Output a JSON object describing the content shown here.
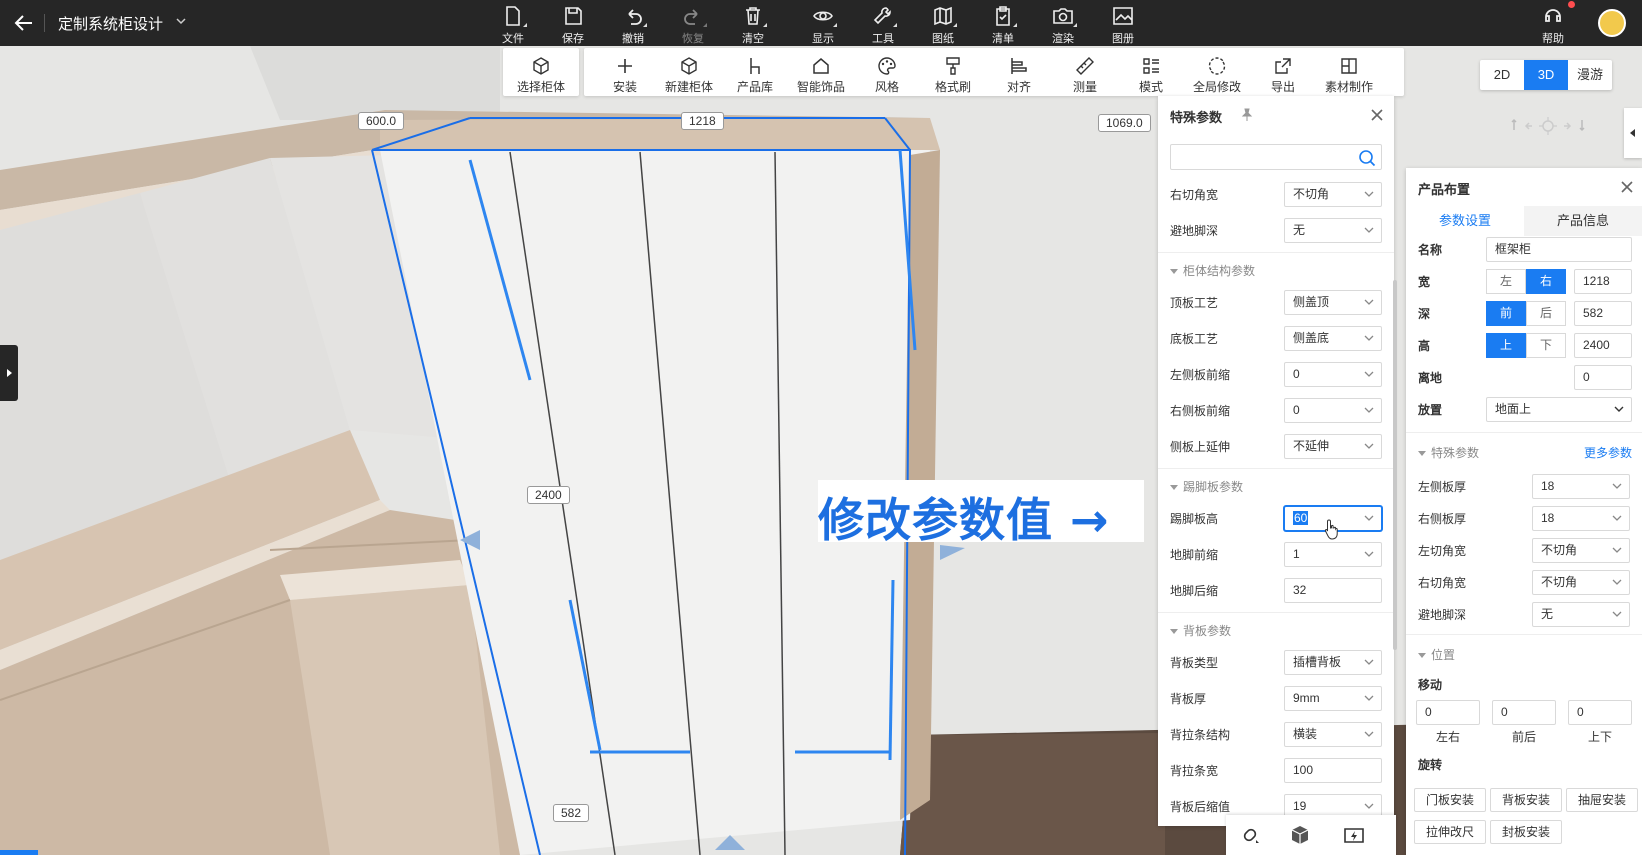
{
  "app": {
    "title": "定制系统柜设计"
  },
  "topbar": {
    "items": [
      {
        "label": "文件",
        "icon": "file-icon"
      },
      {
        "label": "保存",
        "icon": "save-icon"
      },
      {
        "label": "撤销",
        "icon": "undo-icon"
      },
      {
        "label": "恢复",
        "icon": "redo-icon"
      },
      {
        "label": "清空",
        "icon": "trash-icon"
      },
      {
        "label": "显示",
        "icon": "eye-icon"
      },
      {
        "label": "工具",
        "icon": "wrench-icon"
      },
      {
        "label": "图纸",
        "icon": "map-icon"
      },
      {
        "label": "清单",
        "icon": "clipboard-icon"
      },
      {
        "label": "渲染",
        "icon": "camera-icon"
      },
      {
        "label": "图册",
        "icon": "album-icon"
      }
    ],
    "help_label": "帮助"
  },
  "toolbar2": {
    "select_cabinet": "选择柜体",
    "items": [
      {
        "label": "安装",
        "icon": "plus-icon"
      },
      {
        "label": "新建柜体",
        "icon": "cube-icon"
      },
      {
        "label": "产品库",
        "icon": "chair-icon"
      },
      {
        "label": "智能饰品",
        "icon": "decor-icon"
      },
      {
        "label": "风格",
        "icon": "palette-icon"
      },
      {
        "label": "格式刷",
        "icon": "brush-icon"
      },
      {
        "label": "对齐",
        "icon": "align-icon"
      },
      {
        "label": "测量",
        "icon": "ruler-icon"
      },
      {
        "label": "模式",
        "icon": "mode-icon"
      },
      {
        "label": "全局修改",
        "icon": "global-edit-icon"
      },
      {
        "label": "导出",
        "icon": "export-icon"
      },
      {
        "label": "素材制作",
        "icon": "material-icon"
      }
    ]
  },
  "view": {
    "modes": [
      "2D",
      "3D",
      "漫游"
    ],
    "active": "3D"
  },
  "scene": {
    "dims": {
      "d1": "600.0",
      "d2": "1218",
      "d3": "1069.0",
      "height": "2400",
      "depth": "582"
    },
    "callout": "修改参数值 →"
  },
  "special_panel": {
    "title": "特殊参数",
    "search_placeholder": "",
    "rows_top": [
      {
        "label": "右切角宽",
        "value": "不切角"
      },
      {
        "label": "避地脚深",
        "value": "无"
      }
    ],
    "section_structure": "柜体结构参数",
    "rows_structure": [
      {
        "label": "顶板工艺",
        "value": "侧盖顶"
      },
      {
        "label": "底板工艺",
        "value": "侧盖底"
      },
      {
        "label": "左侧板前缩",
        "value": "0"
      },
      {
        "label": "右侧板前缩",
        "value": "0"
      },
      {
        "label": "侧板上延伸",
        "value": "不延伸"
      }
    ],
    "section_kick": "踢脚板参数",
    "rows_kick": [
      {
        "label": "踢脚板高",
        "value": "60"
      },
      {
        "label": "地脚前缩",
        "value": "1"
      },
      {
        "label": "地脚后缩",
        "value": "32"
      }
    ],
    "section_back": "背板参数",
    "rows_back": [
      {
        "label": "背板类型",
        "value": "插槽背板"
      },
      {
        "label": "背板厚",
        "value": "9mm"
      },
      {
        "label": "背拉条结构",
        "value": "横装"
      },
      {
        "label": "背拉条宽",
        "value": "100"
      },
      {
        "label": "背板后缩值",
        "value": "19"
      }
    ]
  },
  "product_panel": {
    "title": "产品布置",
    "tabs": [
      "参数设置",
      "产品信息"
    ],
    "name_label": "名称",
    "name_value": "框架柜",
    "width_label": "宽",
    "width_left": "左",
    "width_right": "右",
    "width_value": "1218",
    "depth_label": "深",
    "depth_front": "前",
    "depth_back": "后",
    "depth_value": "582",
    "height_label": "高",
    "height_up": "上",
    "height_down": "下",
    "height_value": "2400",
    "ground_label": "离地",
    "ground_value": "0",
    "place_label": "放置",
    "place_value": "地面上",
    "section_special": "特殊参数",
    "more_label": "更多参数",
    "special_rows": [
      {
        "label": "左侧板厚",
        "value": "18"
      },
      {
        "label": "右侧板厚",
        "value": "18"
      },
      {
        "label": "左切角宽",
        "value": "不切角"
      },
      {
        "label": "右切角宽",
        "value": "不切角"
      },
      {
        "label": "避地脚深",
        "value": "无"
      }
    ],
    "section_position": "位置",
    "move_label": "移动",
    "move_values": [
      "0",
      "0",
      "0"
    ],
    "move_axes": [
      "左右",
      "前后",
      "上下"
    ],
    "rotate_label": "旋转",
    "buttons": [
      "门板安装",
      "背板安装",
      "抽屉安装",
      "拉伸改尺",
      "封板安装"
    ]
  }
}
